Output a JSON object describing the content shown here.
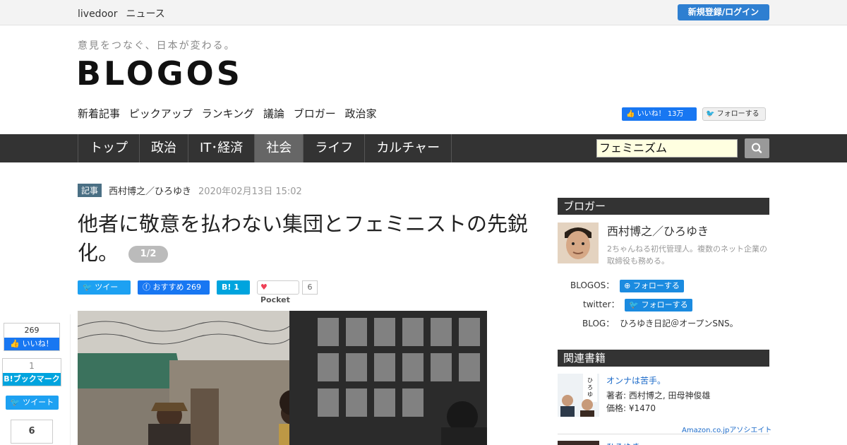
{
  "topbar": {
    "brand_1": "livedoor",
    "brand_2": "ニュース",
    "login_label": "新規登録/ログイン"
  },
  "header": {
    "tagline": "意見をつなぐ、日本が変わる。",
    "logo": "BLOGOS",
    "subnav": [
      "新着記事",
      "ピックアップ",
      "ランキング",
      "議論",
      "ブロガー",
      "政治家"
    ],
    "fb_like_label": "いいね！ 13万",
    "tw_follow_label": "フォローする"
  },
  "mainnav": {
    "items": [
      "トップ",
      "政治",
      "IT･経済",
      "社会",
      "ライフ",
      "カルチャー"
    ],
    "active": "社会",
    "search_value": "フェミニズム"
  },
  "article": {
    "tag": "記事",
    "author": "西村博之／ひろゆき",
    "date": "2020年02月13日 15:02",
    "title": "他者に敬意を払わない集団とフェミニストの先鋭化。",
    "pager": "1/2",
    "share": {
      "tweet": "ツイート",
      "fb": "おすすめ 269",
      "hatena": "B! 1",
      "pocket": "Pocket",
      "pocket_count": "6"
    }
  },
  "side_share": {
    "fb_count": "269",
    "fb_label": "いいね！",
    "hb_count": "1",
    "hb_label": "B!ブックマーク",
    "tweet_label": "ツイート",
    "pocket_count": "6"
  },
  "blogger": {
    "heading": "ブロガー",
    "name": "西村博之／ひろゆき",
    "desc": "2ちゃんねる初代管理人。複数のネット企業の取締役も務める。",
    "blogos_label": "BLOGOS：",
    "blogos_follow": "フォローする",
    "twitter_label": "twitter：",
    "twitter_follow": "フォローする",
    "blog_label": "BLOG：",
    "blog_value": "ひろゆき日記＠オープンSNS。"
  },
  "books": {
    "heading": "関連書籍",
    "title": "オンナは苦手。",
    "author": "著者: 西村博之, 田母神俊雄",
    "price": "価格: ¥1470",
    "amazon": "Amazon.co.jpアソシエイト",
    "title2": "ひろゆき"
  },
  "colors": {
    "accent_blue": "#2e7fd1",
    "nav_bg": "#333333",
    "facebook": "#1877f2",
    "twitter": "#1da1f2",
    "hatena": "#00a4de"
  }
}
